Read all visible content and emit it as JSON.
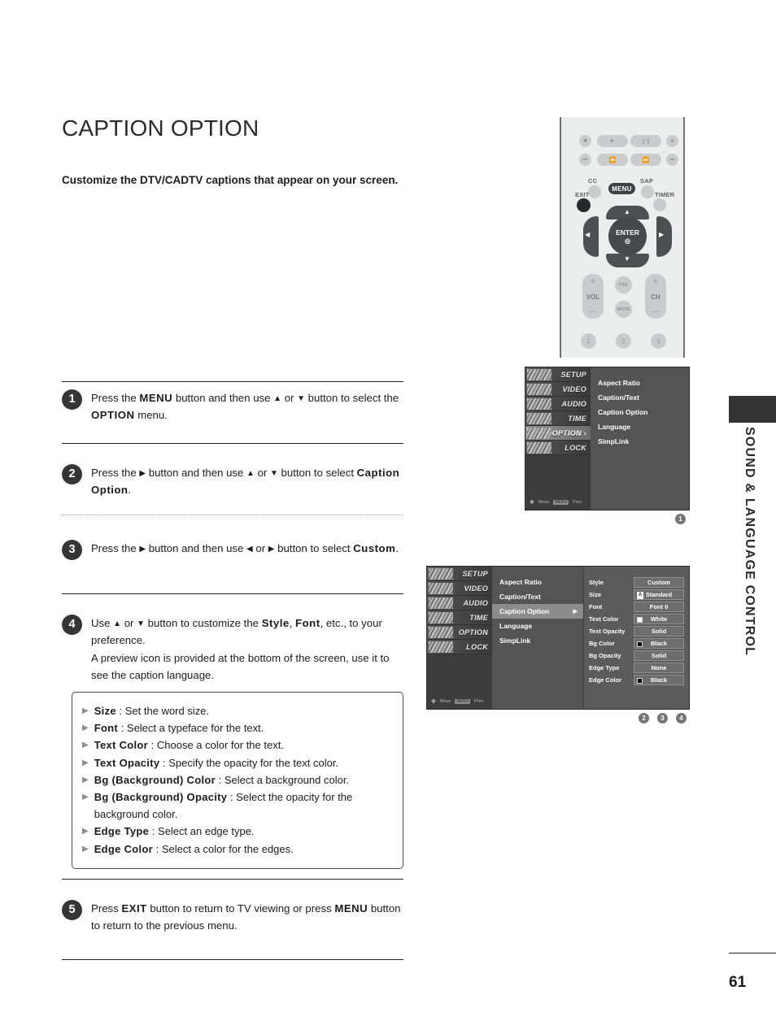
{
  "page": {
    "title": "CAPTION OPTION",
    "intro": "Customize the DTV/CADTV captions that appear on your screen.",
    "number": "61",
    "side_tab_text": "SOUND & LANGUAGE CONTROL"
  },
  "steps": [
    {
      "num": "1",
      "html": "Press the <b>MENU</b> button and then use <span class=\"glyph\">▲</span> or <span class=\"glyph\">▼</span> button to select the <b>OPTION</b> menu."
    },
    {
      "num": "2",
      "html": "Press the <span class=\"glyph\">▶</span> button and then use <span class=\"glyph\">▲</span> or <span class=\"glyph\">▼</span> button to select <b>Caption Option</b>."
    },
    {
      "num": "3",
      "html": "Press the <span class=\"glyph\">▶</span> button and then use <span class=\"glyph\">◀</span> or <span class=\"glyph\">▶</span> button to select <b>Custom</b>."
    },
    {
      "num": "4",
      "html": "Use <span class=\"glyph\">▲</span> or <span class=\"glyph\">▼</span> button to customize the <b>Style</b>, <b>Font</b>, etc., to your preference.<br>A preview icon is provided at the bottom of the screen, use it to see the caption language."
    },
    {
      "num": "5",
      "html": "Press <b>EXIT</b> button to return to TV viewing or press <b>MENU</b> button to return to the previous menu."
    }
  ],
  "bullets": [
    {
      "term": "Size",
      "desc": ": Set the word size."
    },
    {
      "term": "Font",
      "desc": ": Select a typeface for the text."
    },
    {
      "term": "Text Color",
      "desc": ": Choose a color for the text."
    },
    {
      "term": "Text Opacity",
      "desc": ": Specify the opacity for the text color."
    },
    {
      "term": "Bg (Background) Color",
      "desc": ": Select a background color."
    },
    {
      "term": "Bg (Background) Opacity",
      "desc": ": Select the opacity for the background color."
    },
    {
      "term": "Edge Type",
      "desc": ": Select an edge type."
    },
    {
      "term": "Edge Color",
      "desc": ": Select a color for the edges."
    }
  ],
  "remote": {
    "transport_top": [
      "stop-icon",
      "play-icon",
      "pause-icon",
      "record-icon"
    ],
    "transport_bottom": [
      "skip-back-icon",
      "rewind-icon",
      "fast-forward-icon",
      "skip-forward-icon"
    ],
    "labels": {
      "cc": "CC",
      "sap": "SAP",
      "timer": "TIMER",
      "exit": "EXIT",
      "menu": "MENU",
      "enter": "ENTER",
      "vol": "VOL",
      "ch": "CH",
      "fav": "FAV",
      "mute": "MUTE",
      "plus": "+",
      "minus": "—"
    },
    "numbers": [
      "1",
      "2",
      "3"
    ]
  },
  "tv_menu_1": {
    "rail": [
      {
        "label": "SETUP",
        "active": false,
        "arrow": ""
      },
      {
        "label": "VIDEO",
        "active": false,
        "arrow": ""
      },
      {
        "label": "AUDIO",
        "active": false,
        "arrow": ""
      },
      {
        "label": "TIME",
        "active": false,
        "arrow": ""
      },
      {
        "label": "OPTION",
        "active": true,
        "arrow": "›"
      },
      {
        "label": "LOCK",
        "active": false,
        "arrow": ""
      }
    ],
    "foot": {
      "move": "Move",
      "prev": "Prev",
      "prev_key": "MENU"
    },
    "items": [
      {
        "label": "Aspect Ratio",
        "selected": false,
        "arrow": ""
      },
      {
        "label": "Caption/Text",
        "selected": false,
        "arrow": ""
      },
      {
        "label": "Caption Option",
        "selected": false,
        "arrow": ""
      },
      {
        "label": "Language",
        "selected": false,
        "arrow": ""
      },
      {
        "label": "SimpLink",
        "selected": false,
        "arrow": ""
      }
    ],
    "badge": "1"
  },
  "tv_menu_2": {
    "rail": [
      {
        "label": "SETUP",
        "active": false
      },
      {
        "label": "VIDEO",
        "active": false
      },
      {
        "label": "AUDIO",
        "active": false
      },
      {
        "label": "TIME",
        "active": false
      },
      {
        "label": "OPTION",
        "active": false
      },
      {
        "label": "LOCK",
        "active": false
      }
    ],
    "foot": {
      "move": "Move",
      "prev": "Prev",
      "prev_key": "MENU"
    },
    "items": [
      {
        "label": "Aspect Ratio",
        "selected": false,
        "arrow": ""
      },
      {
        "label": "Caption/Text",
        "selected": false,
        "arrow": ""
      },
      {
        "label": "Caption Option",
        "selected": true,
        "arrow": "▶"
      },
      {
        "label": "Language",
        "selected": false,
        "arrow": ""
      },
      {
        "label": "SimpLink",
        "selected": false,
        "arrow": ""
      }
    ],
    "settings": [
      {
        "label": "Style",
        "value": "Custom",
        "swatch": "",
        "glyph": ""
      },
      {
        "label": "Size",
        "value": "Standard",
        "swatch": "",
        "glyph": "A"
      },
      {
        "label": "Font",
        "value": "Font  0",
        "swatch": "",
        "glyph": ""
      },
      {
        "label": "Text Color",
        "value": "White",
        "swatch": "#ffffff",
        "glyph": ""
      },
      {
        "label": "Text Opacity",
        "value": "Solid",
        "swatch": "",
        "glyph": ""
      },
      {
        "label": "Bg Color",
        "value": "Black",
        "swatch": "#000000",
        "glyph": ""
      },
      {
        "label": "Bg Opacity",
        "value": "Solid",
        "swatch": "",
        "glyph": ""
      },
      {
        "label": "Edge Type",
        "value": "None",
        "swatch": "",
        "glyph": ""
      },
      {
        "label": "Edge Color",
        "value": "Black",
        "swatch": "#000000",
        "glyph": ""
      }
    ],
    "badges": [
      "2",
      "3",
      "4"
    ]
  },
  "colors": {
    "text": "#231f20",
    "badge_dark": "#353535",
    "fig_badge": "#757575",
    "side_tab": "#333333",
    "remote_body": "#eceded",
    "tv_bg": "#545454"
  }
}
